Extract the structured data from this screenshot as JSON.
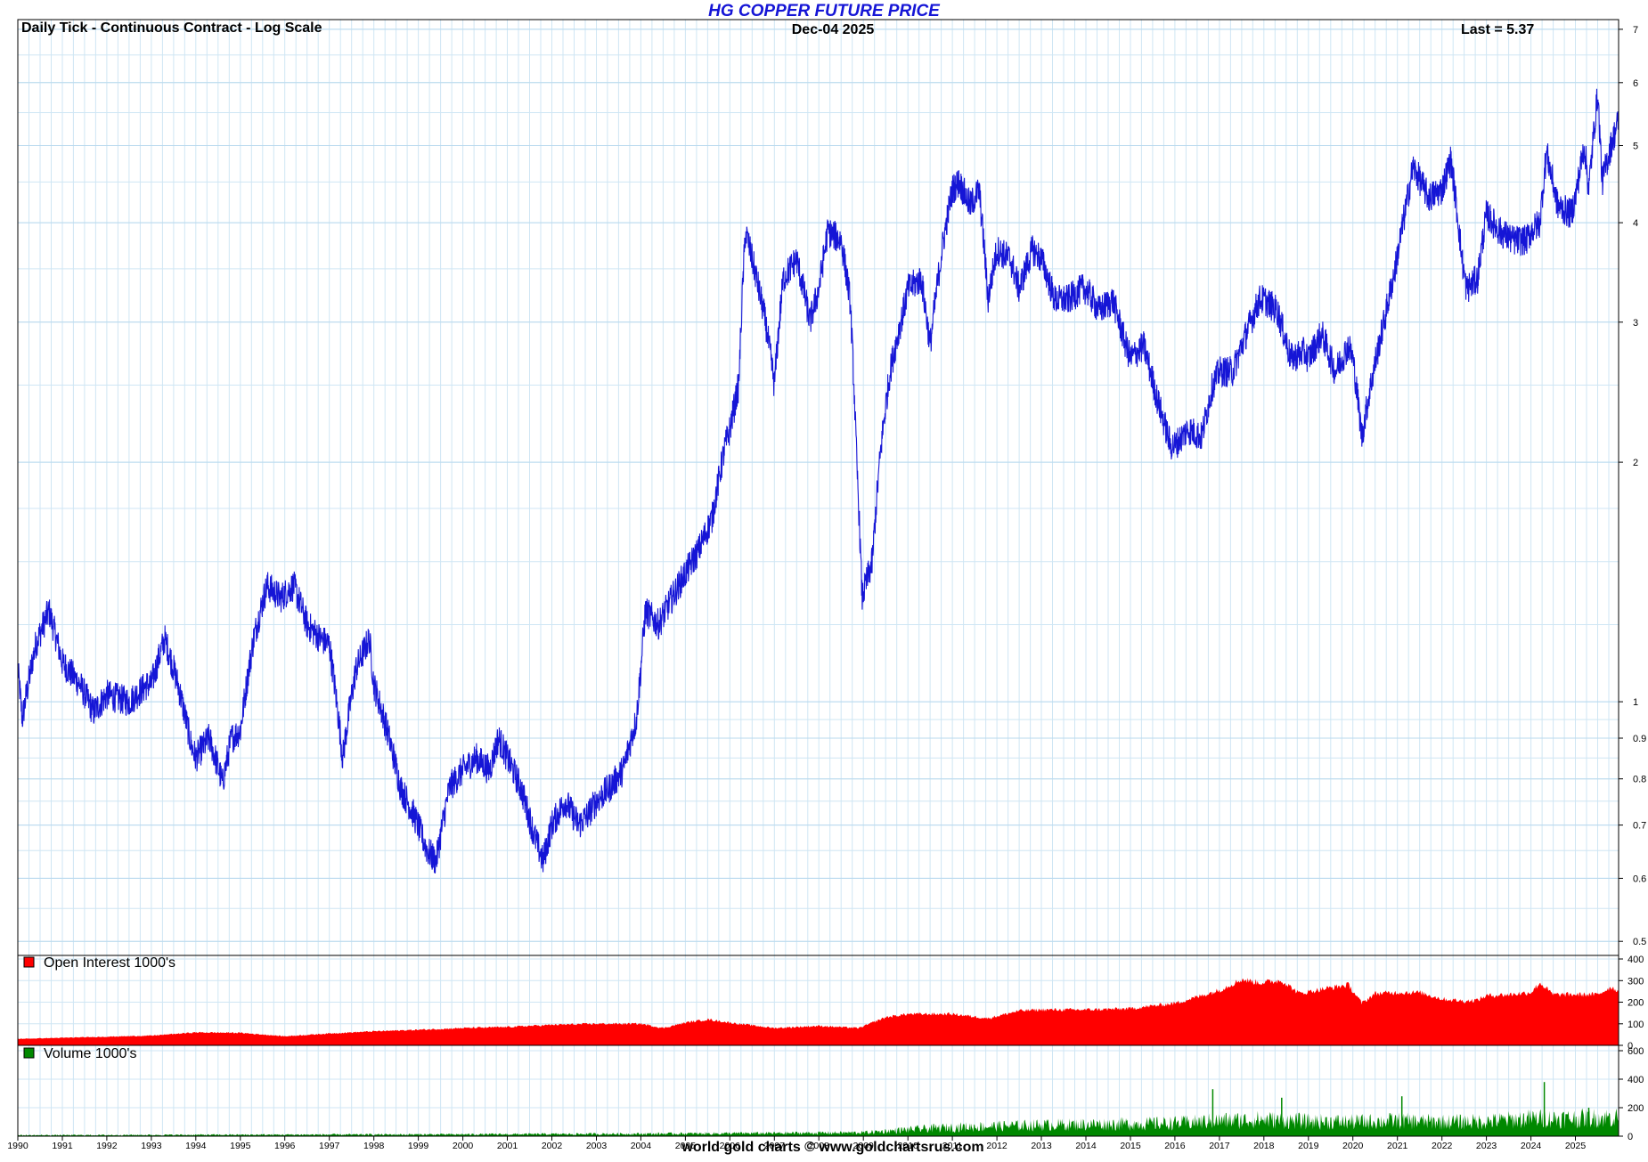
{
  "header": {
    "title": "HG COPPER FUTURE PRICE",
    "subtitle": "Daily Tick - Continuous Contract - Log Scale",
    "date": "Dec-04  2025",
    "last": "Last = 5.37"
  },
  "footer": "world gold charts © www.goldchartsrus.com",
  "colors": {
    "price": "#1515d6",
    "open_interest": "#ff0000",
    "volume": "#008800",
    "grid": "#cfe6f4"
  },
  "chart_data": [
    {
      "type": "line",
      "title": "HG COPPER FUTURE PRICE",
      "scale": "log",
      "ylim": [
        0.48,
        7.2
      ],
      "xlim": [
        1990.0,
        2025.97
      ],
      "grid": true,
      "y_ticks": [
        0.5,
        0.6,
        0.7,
        0.8,
        0.9,
        1,
        2,
        3,
        4,
        5,
        6,
        7
      ],
      "x_tick_labels": [
        "1990",
        "1991",
        "1992",
        "1993",
        "1994",
        "1995",
        "1996",
        "1997",
        "1998",
        "1999",
        "2000",
        "2001",
        "2002",
        "2003",
        "2004",
        "2005",
        "2006",
        "2007",
        "2008",
        "2009",
        "2010",
        "2011",
        "2012",
        "2013",
        "2014",
        "2015",
        "2016",
        "2017",
        "2018",
        "2019",
        "2020",
        "2021",
        "2022",
        "2023",
        "2024",
        "2025"
      ],
      "series": [
        {
          "values": [
            [
              1990.0,
              1.1
            ],
            [
              1990.1,
              0.95
            ],
            [
              1990.4,
              1.18
            ],
            [
              1990.7,
              1.3
            ],
            [
              1991.0,
              1.12
            ],
            [
              1991.4,
              1.05
            ],
            [
              1991.7,
              0.97
            ],
            [
              1992.0,
              1.02
            ],
            [
              1992.5,
              1.0
            ],
            [
              1992.9,
              1.05
            ],
            [
              1993.0,
              1.05
            ],
            [
              1993.3,
              1.2
            ],
            [
              1993.6,
              1.05
            ],
            [
              1993.9,
              0.88
            ],
            [
              1994.0,
              0.85
            ],
            [
              1994.3,
              0.9
            ],
            [
              1994.6,
              0.79
            ],
            [
              1994.8,
              0.9
            ],
            [
              1995.0,
              0.92
            ],
            [
              1995.3,
              1.2
            ],
            [
              1995.6,
              1.4
            ],
            [
              1995.9,
              1.35
            ],
            [
              1996.2,
              1.4
            ],
            [
              1996.5,
              1.25
            ],
            [
              1996.8,
              1.2
            ],
            [
              1997.0,
              1.18
            ],
            [
              1997.3,
              0.85
            ],
            [
              1997.6,
              1.1
            ],
            [
              1997.9,
              1.2
            ],
            [
              1998.0,
              1.05
            ],
            [
              1998.3,
              0.92
            ],
            [
              1998.6,
              0.78
            ],
            [
              1998.9,
              0.72
            ],
            [
              1999.2,
              0.65
            ],
            [
              1999.4,
              0.63
            ],
            [
              1999.7,
              0.78
            ],
            [
              2000.0,
              0.82
            ],
            [
              2000.3,
              0.85
            ],
            [
              2000.6,
              0.82
            ],
            [
              2000.8,
              0.9
            ],
            [
              2001.0,
              0.85
            ],
            [
              2001.3,
              0.78
            ],
            [
              2001.6,
              0.68
            ],
            [
              2001.8,
              0.63
            ],
            [
              2002.0,
              0.7
            ],
            [
              2002.3,
              0.75
            ],
            [
              2002.6,
              0.7
            ],
            [
              2002.8,
              0.72
            ],
            [
              2003.0,
              0.75
            ],
            [
              2003.3,
              0.78
            ],
            [
              2003.6,
              0.82
            ],
            [
              2003.9,
              0.95
            ],
            [
              2004.0,
              1.1
            ],
            [
              2004.1,
              1.3
            ],
            [
              2004.4,
              1.25
            ],
            [
              2004.7,
              1.35
            ],
            [
              2005.0,
              1.45
            ],
            [
              2005.3,
              1.55
            ],
            [
              2005.6,
              1.7
            ],
            [
              2005.9,
              2.1
            ],
            [
              2006.0,
              2.2
            ],
            [
              2006.2,
              2.5
            ],
            [
              2006.35,
              3.9
            ],
            [
              2006.6,
              3.4
            ],
            [
              2006.8,
              3.0
            ],
            [
              2007.0,
              2.5
            ],
            [
              2007.2,
              3.4
            ],
            [
              2007.5,
              3.6
            ],
            [
              2007.8,
              3.0
            ],
            [
              2008.0,
              3.3
            ],
            [
              2008.2,
              3.9
            ],
            [
              2008.5,
              3.8
            ],
            [
              2008.7,
              3.2
            ],
            [
              2008.85,
              2.0
            ],
            [
              2008.97,
              1.35
            ],
            [
              2009.2,
              1.5
            ],
            [
              2009.4,
              2.1
            ],
            [
              2009.6,
              2.6
            ],
            [
              2009.9,
              3.1
            ],
            [
              2010.0,
              3.3
            ],
            [
              2010.3,
              3.4
            ],
            [
              2010.5,
              2.8
            ],
            [
              2010.8,
              3.8
            ],
            [
              2011.0,
              4.4
            ],
            [
              2011.15,
              4.5
            ],
            [
              2011.4,
              4.2
            ],
            [
              2011.6,
              4.4
            ],
            [
              2011.8,
              3.2
            ],
            [
              2012.0,
              3.7
            ],
            [
              2012.3,
              3.6
            ],
            [
              2012.5,
              3.3
            ],
            [
              2012.8,
              3.7
            ],
            [
              2013.0,
              3.6
            ],
            [
              2013.3,
              3.2
            ],
            [
              2013.6,
              3.2
            ],
            [
              2013.9,
              3.3
            ],
            [
              2014.0,
              3.3
            ],
            [
              2014.3,
              3.1
            ],
            [
              2014.6,
              3.2
            ],
            [
              2014.9,
              2.8
            ],
            [
              2015.0,
              2.7
            ],
            [
              2015.3,
              2.8
            ],
            [
              2015.6,
              2.4
            ],
            [
              2015.9,
              2.1
            ],
            [
              2016.0,
              2.1
            ],
            [
              2016.3,
              2.2
            ],
            [
              2016.6,
              2.15
            ],
            [
              2016.85,
              2.5
            ],
            [
              2017.0,
              2.6
            ],
            [
              2017.3,
              2.6
            ],
            [
              2017.6,
              2.9
            ],
            [
              2017.9,
              3.2
            ],
            [
              2018.0,
              3.2
            ],
            [
              2018.3,
              3.1
            ],
            [
              2018.6,
              2.7
            ],
            [
              2018.9,
              2.75
            ],
            [
              2019.0,
              2.7
            ],
            [
              2019.3,
              2.9
            ],
            [
              2019.6,
              2.6
            ],
            [
              2019.9,
              2.8
            ],
            [
              2020.0,
              2.7
            ],
            [
              2020.2,
              2.15
            ],
            [
              2020.4,
              2.5
            ],
            [
              2020.7,
              3.0
            ],
            [
              2020.95,
              3.5
            ],
            [
              2021.2,
              4.2
            ],
            [
              2021.35,
              4.7
            ],
            [
              2021.7,
              4.3
            ],
            [
              2022.0,
              4.4
            ],
            [
              2022.2,
              4.8
            ],
            [
              2022.45,
              3.6
            ],
            [
              2022.55,
              3.3
            ],
            [
              2022.8,
              3.4
            ],
            [
              2023.0,
              4.1
            ],
            [
              2023.3,
              3.9
            ],
            [
              2023.6,
              3.8
            ],
            [
              2023.9,
              3.8
            ],
            [
              2024.0,
              3.9
            ],
            [
              2024.2,
              4.0
            ],
            [
              2024.35,
              4.9
            ],
            [
              2024.6,
              4.2
            ],
            [
              2024.9,
              4.1
            ],
            [
              2025.0,
              4.3
            ],
            [
              2025.2,
              5.0
            ],
            [
              2025.3,
              4.4
            ],
            [
              2025.5,
              5.8
            ],
            [
              2025.6,
              4.5
            ],
            [
              2025.8,
              5.0
            ],
            [
              2025.97,
              5.37
            ]
          ]
        }
      ]
    },
    {
      "type": "area",
      "legend": "Open Interest 1000's",
      "ylim": [
        0,
        400
      ],
      "y_ticks": [
        0,
        100,
        200,
        300,
        400
      ],
      "grid": true,
      "series": [
        {
          "name": "Open Interest 1000's",
          "values": [
            [
              1990.0,
              30
            ],
            [
              1991.0,
              35
            ],
            [
              1992.0,
              40
            ],
            [
              1993.0,
              45
            ],
            [
              1994.0,
              60
            ],
            [
              1995.0,
              58
            ],
            [
              1996.0,
              42
            ],
            [
              1997.0,
              55
            ],
            [
              1998.0,
              65
            ],
            [
              1999.0,
              72
            ],
            [
              2000.0,
              80
            ],
            [
              2001.0,
              85
            ],
            [
              2002.0,
              95
            ],
            [
              2003.0,
              100
            ],
            [
              2004.0,
              100
            ],
            [
              2004.5,
              80
            ],
            [
              2005.0,
              105
            ],
            [
              2005.5,
              120
            ],
            [
              2006.0,
              105
            ],
            [
              2007.0,
              80
            ],
            [
              2008.0,
              90
            ],
            [
              2008.9,
              80
            ],
            [
              2009.5,
              130
            ],
            [
              2010.0,
              145
            ],
            [
              2011.0,
              145
            ],
            [
              2011.8,
              125
            ],
            [
              2012.5,
              160
            ],
            [
              2013.0,
              165
            ],
            [
              2014.0,
              165
            ],
            [
              2015.0,
              170
            ],
            [
              2016.0,
              195
            ],
            [
              2016.6,
              230
            ],
            [
              2017.0,
              255
            ],
            [
              2017.5,
              305
            ],
            [
              2017.9,
              290
            ],
            [
              2018.4,
              300
            ],
            [
              2018.8,
              240
            ],
            [
              2019.3,
              260
            ],
            [
              2019.9,
              280
            ],
            [
              2020.2,
              195
            ],
            [
              2020.5,
              240
            ],
            [
              2021.0,
              245
            ],
            [
              2021.5,
              245
            ],
            [
              2022.0,
              215
            ],
            [
              2022.5,
              205
            ],
            [
              2022.8,
              210
            ],
            [
              2023.0,
              230
            ],
            [
              2023.5,
              235
            ],
            [
              2024.0,
              245
            ],
            [
              2024.2,
              290
            ],
            [
              2024.5,
              235
            ],
            [
              2025.0,
              235
            ],
            [
              2025.5,
              235
            ],
            [
              2025.8,
              270
            ],
            [
              2025.97,
              250
            ]
          ]
        }
      ]
    },
    {
      "type": "area",
      "legend": "Volume 1000's",
      "ylim": [
        0,
        600
      ],
      "y_ticks": [
        0,
        200,
        400,
        600
      ],
      "grid": true,
      "series": [
        {
          "name": "Volume 1000's",
          "values": [
            [
              1990.0,
              8
            ],
            [
              1995.0,
              12
            ],
            [
              2000.0,
              15
            ],
            [
              2004.0,
              20
            ],
            [
              2007.0,
              25
            ],
            [
              2009.0,
              30
            ],
            [
              2010.0,
              55
            ],
            [
              2011.0,
              75
            ],
            [
              2012.0,
              85
            ],
            [
              2013.0,
              95
            ],
            [
              2014.0,
              100
            ],
            [
              2015.0,
              105
            ],
            [
              2016.0,
              110
            ],
            [
              2017.0,
              130
            ],
            [
              2018.0,
              140
            ],
            [
              2019.0,
              125
            ],
            [
              2020.0,
              120
            ],
            [
              2021.0,
              130
            ],
            [
              2022.0,
              120
            ],
            [
              2023.0,
              125
            ],
            [
              2024.0,
              150
            ],
            [
              2025.0,
              150
            ],
            [
              2025.97,
              160
            ]
          ],
          "spikes": [
            [
              2016.85,
              330
            ],
            [
              2018.4,
              270
            ],
            [
              2021.1,
              280
            ],
            [
              2024.3,
              380
            ],
            [
              2025.3,
              200
            ]
          ]
        }
      ]
    }
  ]
}
